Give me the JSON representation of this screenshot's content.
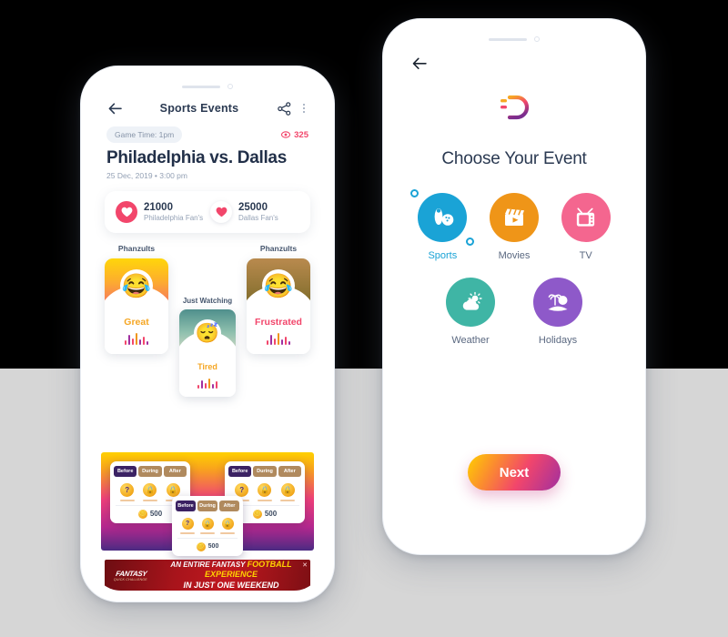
{
  "left_phone": {
    "header": {
      "back_icon": "arrow-left-icon",
      "title": "Sports Events",
      "share_icon": "share-icon",
      "menu_icon": "more-vertical-icon"
    },
    "game_time_chip": "Game Time: 1pm",
    "views": {
      "icon": "eye-icon",
      "count": "325"
    },
    "event_title": "Philadelphia vs. Dallas",
    "event_datetime": "25 Dec, 2019 • 3:00 pm",
    "fans": [
      {
        "count": "21000",
        "label": "Philadelphia Fan's",
        "icon": "heart-icon",
        "style": "filled"
      },
      {
        "count": "25000",
        "label": "Dallas Fan's",
        "icon": "heart-icon",
        "style": "plain"
      }
    ],
    "moods": [
      {
        "section_label": "Phanzults",
        "name": "Great",
        "emoji": "😂"
      },
      {
        "section_label": "Just Watching",
        "name": "Tired",
        "emoji": "😴"
      },
      {
        "section_label": "Phanzults",
        "name": "Frustrated",
        "emoji": "😂"
      }
    ],
    "bet_cards": [
      {
        "tabs": [
          "Before",
          "During",
          "After"
        ],
        "active_tab": "Before",
        "coins": [
          "?",
          "🔒",
          "🔒"
        ],
        "amount": "500"
      },
      {
        "tabs": [
          "Before",
          "During",
          "After"
        ],
        "active_tab": "Before",
        "coins": [
          "?",
          "🔒",
          "🔒"
        ],
        "amount": "500"
      },
      {
        "tabs": [
          "Before",
          "During",
          "After"
        ],
        "active_tab": "Before",
        "coins": [
          "?",
          "🔒",
          "🔒"
        ],
        "amount": "500"
      }
    ],
    "ad": {
      "brand": "FANTASY",
      "brand_sub": "QUICK CHALLENGE",
      "line1_plain": "AN ENTIRE FANTASY ",
      "line1_accent": "FOOTBALL EXPERIENCE",
      "line2": "IN JUST ONE WEEKEND",
      "close_icon": "close-icon"
    }
  },
  "right_phone": {
    "back_icon": "arrow-left-icon",
    "logo": "brand-p-logo",
    "heading": "Choose Your Event",
    "categories": [
      {
        "label": "Sports",
        "icon": "bowling-icon",
        "color": "#1aa3d6",
        "selected": true
      },
      {
        "label": "Movies",
        "icon": "clapper-icon",
        "color": "#ef9518",
        "selected": false
      },
      {
        "label": "TV",
        "icon": "tv-icon",
        "color": "#f4668f",
        "selected": false
      },
      {
        "label": "Weather",
        "icon": "sun-cloud-icon",
        "color": "#3fb5a5",
        "selected": false
      },
      {
        "label": "Holidays",
        "icon": "island-icon",
        "color": "#8e59c9",
        "selected": false
      }
    ],
    "next_label": "Next"
  },
  "colors": {
    "accent_pink": "#f2466b",
    "accent_blue": "#1aa3d6",
    "accent_yellow": "#ffd000",
    "text_dark": "#2b3a52",
    "bg_top": "#000000",
    "bg_bottom": "#d6d6d6"
  }
}
